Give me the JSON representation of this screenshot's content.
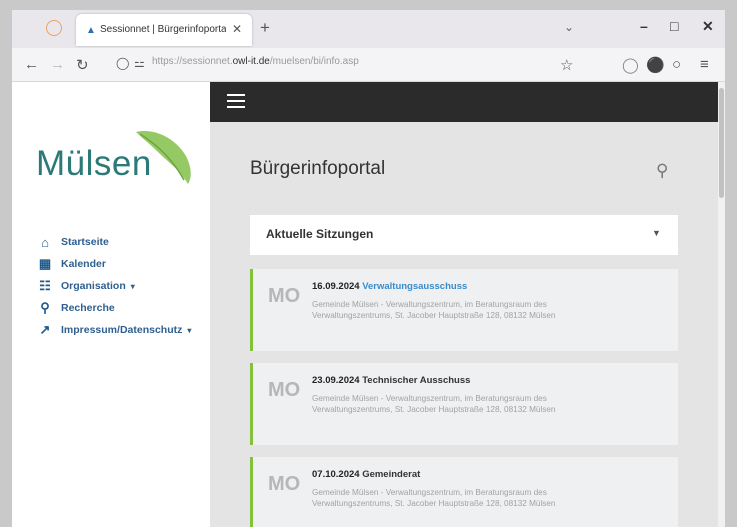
{
  "browser": {
    "tab_title": "Sessionnet | Bürgerinfoportal",
    "url_prefix": "https://sessionnet.",
    "url_domain": "owl-it.de",
    "url_suffix": "/muelsen/bi/info.asp"
  },
  "sidebar": {
    "logo": "Mülsen",
    "items": [
      {
        "label": "Startseite",
        "icon": "home-icon"
      },
      {
        "label": "Kalender",
        "icon": "calendar-icon"
      },
      {
        "label": "Organisation",
        "icon": "organisation-icon",
        "caret": "▾"
      },
      {
        "label": "Recherche",
        "icon": "search-icon"
      },
      {
        "label": "Impressum/Datenschutz",
        "icon": "external-link-icon",
        "caret": "▾"
      }
    ]
  },
  "main": {
    "title": "Bürgerinfoportal",
    "panel_title": "Aktuelle Sitzungen",
    "events": [
      {
        "day": "MO",
        "date": "16.09.2024",
        "name": "Verwaltungsausschuss",
        "location": "Gemeinde Mülsen - Verwaltungszentrum, im Beratungsraum des Verwaltungszentrums, St. Jacober Hauptstraße 128, 08132 Mülsen"
      },
      {
        "day": "MO",
        "date": "23.09.2024",
        "name": "Technischer Ausschuss",
        "location": "Gemeinde Mülsen - Verwaltungszentrum, im Beratungsraum des Verwaltungszentrums, St. Jacober Hauptstraße 128, 08132 Mülsen"
      },
      {
        "day": "MO",
        "date": "07.10.2024",
        "name": "Gemeinderat",
        "location": "Gemeinde Mülsen - Verwaltungszentrum, im Beratungsraum des Verwaltungszentrums, St. Jacober Hauptstraße 128, 08132 Mülsen"
      }
    ]
  },
  "colors": {
    "accent_green": "#86c13e",
    "link_blue": "#3a8cc9",
    "topbar": "#2b2b2b"
  }
}
